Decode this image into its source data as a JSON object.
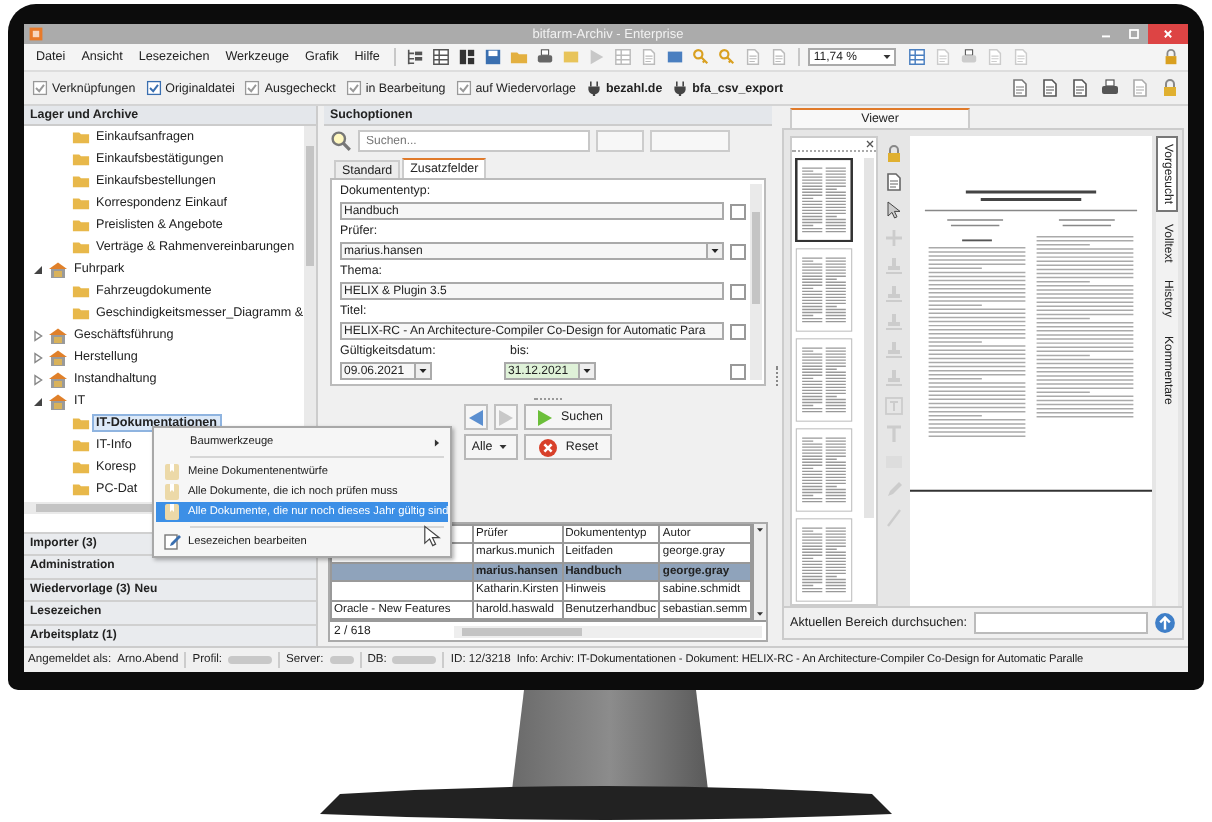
{
  "window": {
    "title": "bitfarm-Archiv - Enterprise"
  },
  "menu": [
    "Datei",
    "Ansicht",
    "Lesezeichen",
    "Werkzeuge",
    "Grafik",
    "Hilfe"
  ],
  "zoom": {
    "value": "11,74 %"
  },
  "quick_filters": [
    {
      "label": "Verknüpfungen",
      "kind": "filter"
    },
    {
      "label": "Originaldatei",
      "kind": "filter"
    },
    {
      "label": "Ausgecheckt",
      "kind": "filter"
    },
    {
      "label": "in Bearbeitung",
      "kind": "filter"
    },
    {
      "label": "auf Wiedervorlage",
      "kind": "filter"
    },
    {
      "label": "bezahl.de",
      "kind": "plugin"
    },
    {
      "label": "bfa_csv_export",
      "kind": "plugin"
    }
  ],
  "archive_panel": {
    "title": "Lager und Archive",
    "tree": {
      "continued": [
        {
          "label": "Einkaufsanfragen",
          "selected": false
        },
        {
          "label": "Einkaufsbestätigungen",
          "selected": false
        },
        {
          "label": "Einkaufsbestellungen",
          "selected": false
        },
        {
          "label": "Korrespondenz Einkauf",
          "selected": false
        },
        {
          "label": "Preislisten & Angebote",
          "selected": false
        },
        {
          "label": "Verträge & Rahmenvereinbarungen",
          "selected": false
        }
      ],
      "nodes": [
        {
          "label": "Fuhrpark",
          "expanded": true,
          "selected": false,
          "children": [
            {
              "label": "Fahrzeugdokumente",
              "selected": false
            },
            {
              "label": "Geschindigkeitsmesser_Diagramm &",
              "selected": false
            }
          ]
        },
        {
          "label": "Geschäftsführung",
          "expanded": false,
          "selected": false
        },
        {
          "label": "Herstellung",
          "expanded": false,
          "selected": false
        },
        {
          "label": "Instandhaltung",
          "expanded": false,
          "selected": false
        },
        {
          "label": "IT",
          "expanded": true,
          "selected": false,
          "children": [
            {
              "label": "IT-Dokumentationen",
              "selected": true
            },
            {
              "label": "IT-Info",
              "selected": false
            },
            {
              "label": "Koresp",
              "selected": false
            },
            {
              "label": "PC-Dat",
              "selected": false
            }
          ]
        }
      ]
    },
    "sections": [
      {
        "label": "Importer (3)"
      },
      {
        "label": "Administration"
      },
      {
        "label": "Wiedervorlage (3)",
        "badge": "Neu"
      },
      {
        "label": "Lesezeichen"
      },
      {
        "label": "Arbeitsplatz (1)"
      }
    ]
  },
  "context_menu": {
    "items": [
      {
        "kind": "submenu",
        "label": "Baumwerkzeuge",
        "selected": false
      },
      {
        "kind": "separator"
      },
      {
        "kind": "bookmark",
        "label": "Meine Dokumentenentwürfe",
        "selected": false
      },
      {
        "kind": "bookmark",
        "label": "Alle Dokumente, die ich noch prüfen muss",
        "selected": false
      },
      {
        "kind": "bookmark",
        "label": "Alle Dokumente, die nur noch dieses Jahr gültig sind",
        "selected": true
      },
      {
        "kind": "separator"
      },
      {
        "kind": "edit",
        "label": "Lesezeichen bearbeiten",
        "selected": false
      }
    ]
  },
  "search": {
    "title": "Suchoptionen",
    "placeholder": "Suchen...",
    "tabs": [
      {
        "label": "Standard",
        "selected": false
      },
      {
        "label": "Zusatzfelder",
        "selected": true
      }
    ],
    "fields": [
      {
        "label": "Dokumententyp:",
        "value": "Handbuch",
        "kind": "text",
        "checked": false
      },
      {
        "label": "Prüfer:",
        "value": "marius.hansen",
        "kind": "dropdown",
        "checked": false
      },
      {
        "label": "Thema:",
        "value": "HELIX & Plugin 3.5",
        "kind": "text",
        "checked": false
      },
      {
        "label": "Titel:",
        "value": "HELIX-RC - An Architecture-Compiler Co-Design for Automatic Para",
        "kind": "text",
        "checked": false
      }
    ],
    "date_range": {
      "from_label": "Gültigkeitsdatum:",
      "from": "09.06.2021",
      "to_label": "bis:",
      "to": "31.12.2021",
      "checked": false
    },
    "buttons": {
      "search": "Suchen",
      "scope": "Alle",
      "reset": "Reset"
    }
  },
  "results": {
    "columns": [
      "Prüfer",
      "Dokumententyp",
      "Autor"
    ],
    "rows": [
      {
        "pruefer": "markus.munich",
        "typ": "Leitfaden",
        "autor": "george.gray",
        "selected": false
      },
      {
        "pruefer": "marius.hansen",
        "typ": "Handbuch",
        "autor": "george.gray",
        "selected": true
      },
      {
        "pruefer": "Katharin.Kirsten",
        "typ": "Hinweis",
        "autor": "sabine.schmidt",
        "selected": false
      },
      {
        "title": "Oracle - New Features",
        "pruefer": "harold.haswald",
        "typ": "Benutzerhandbuc",
        "autor": "sebastian.semm",
        "selected": false
      }
    ],
    "count": "2 / 618"
  },
  "viewer": {
    "tab": "Viewer",
    "thumbnails": [
      {
        "selected": true
      },
      {
        "selected": false
      },
      {
        "selected": false
      },
      {
        "selected": false
      },
      {
        "selected": false
      }
    ],
    "side_tabs": [
      {
        "label": "Vorgesucht",
        "selected": true
      },
      {
        "label": "Volltext",
        "selected": false
      },
      {
        "label": "History",
        "selected": false
      },
      {
        "label": "Kommentare",
        "selected": false
      }
    ],
    "search_label": "Aktuellen Bereich durchsuchen:"
  },
  "status_bar": {
    "user_label": "Angemeldet als:",
    "user": "Arno.Abend",
    "profile_label": "Profil:",
    "server_label": "Server:",
    "db_label": "DB:",
    "id": "ID: 12/3218",
    "info": "Info: Archiv: IT-Dokumentationen - Dokument: HELIX-RC - An Architecture-Compiler Co-Design for Automatic Paralle"
  }
}
